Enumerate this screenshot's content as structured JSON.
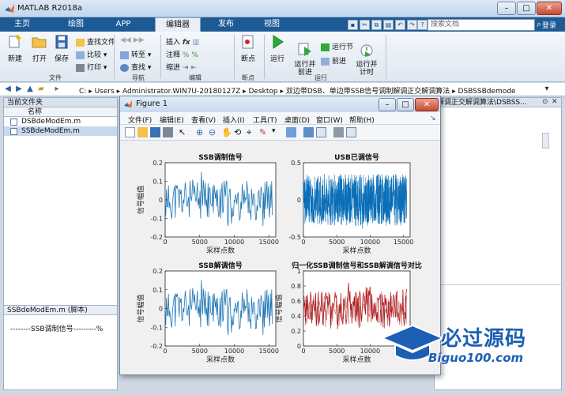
{
  "window": {
    "title": "MATLAB R2018a"
  },
  "tabs": [
    {
      "label": "主页"
    },
    {
      "label": "绘图"
    },
    {
      "label": "APP"
    },
    {
      "label": "编辑器"
    },
    {
      "label": "发布"
    },
    {
      "label": "视图"
    }
  ],
  "search": {
    "placeholder": "搜索文档"
  },
  "login_label": "登录",
  "ribbon": {
    "file": {
      "new": "新建",
      "open": "打开",
      "save": "保存",
      "find_files": "查找文件",
      "compare": "比较",
      "print": "打印",
      "group": "文件"
    },
    "nav": {
      "goto": "转至",
      "find": "查找",
      "group": "导航"
    },
    "edit": {
      "insert": "插入",
      "comment": "注释",
      "indent": "缩进",
      "group": "编辑"
    },
    "breakpoints": {
      "label": "断点",
      "group": "断点"
    },
    "run": {
      "run": "运行",
      "run_advance": "运行并\n前进",
      "run_section": "运行节",
      "advance": "前进",
      "run_time": "运行并\n计时",
      "group": "运行"
    }
  },
  "address": {
    "path": [
      "C:",
      "Users",
      "Administrator.WIN7U-20180127Z",
      "Desktop",
      "双边带DSB、单边带SSB信号调制解调正交解调算法",
      "DSBSSBdemode"
    ]
  },
  "left_panel": {
    "header": "当前文件夹",
    "column": "名称",
    "files": [
      {
        "name": "DSBdeModEm.m",
        "selected": false
      },
      {
        "name": "SSBdeModEm.m",
        "selected": true
      }
    ]
  },
  "right_panel": {
    "header": "解调正交解调算法\\DSBSS..."
  },
  "script_panel": {
    "title": "SSBdeModEm.m (脚本)",
    "line": "--------SSB调制信号---------%"
  },
  "figure": {
    "title": "Figure 1",
    "menu": [
      "文件(F)",
      "编辑(E)",
      "查看(V)",
      "插入(I)",
      "工具(T)",
      "桌面(D)",
      "窗口(W)",
      "帮助(H)"
    ]
  },
  "watermark": {
    "text": "必过源码",
    "url": "Biguo100.com"
  },
  "chart_data": [
    {
      "type": "line",
      "title": "SSB调制信号",
      "xlabel": "采样点数",
      "ylabel": "信号幅值",
      "xlim": [
        0,
        16000
      ],
      "ylim": [
        -0.2,
        0.2
      ],
      "xticks": [
        0,
        5000,
        10000,
        15000
      ],
      "yticks": [
        -0.2,
        -0.1,
        0,
        0.1,
        0.2
      ],
      "color": "#1f77b4",
      "seed": 11
    },
    {
      "type": "line",
      "title": "USB已调信号",
      "xlabel": "采样点数",
      "ylabel": "",
      "xlim": [
        0,
        16000
      ],
      "ylim": [
        -0.5,
        0.5
      ],
      "xticks": [
        0,
        5000,
        10000,
        15000
      ],
      "yticks": [
        -0.5,
        0,
        0.5
      ],
      "color": "#0b6fb8",
      "seed": 23
    },
    {
      "type": "line",
      "title": "SSB解调信号",
      "xlabel": "采样点数",
      "ylabel": "信号幅值",
      "xlim": [
        0,
        16000
      ],
      "ylim": [
        -0.2,
        0.2
      ],
      "xticks": [
        0,
        5000,
        10000,
        15000
      ],
      "yticks": [
        -0.2,
        -0.1,
        0,
        0.1,
        0.2
      ],
      "color": "#1f77b4",
      "seed": 11
    },
    {
      "type": "line",
      "title": "归一化SSB调制信号和SSB解调信号对比",
      "xlabel": "采样点数",
      "ylabel": "信号幅值",
      "xlim": [
        0,
        16000
      ],
      "ylim": [
        0,
        1
      ],
      "xticks": [
        0,
        5000,
        10000,
        15000
      ],
      "yticks": [
        0,
        0.2,
        0.4,
        0.6,
        0.8,
        1
      ],
      "color": "#c0171c",
      "seed": 41
    }
  ]
}
